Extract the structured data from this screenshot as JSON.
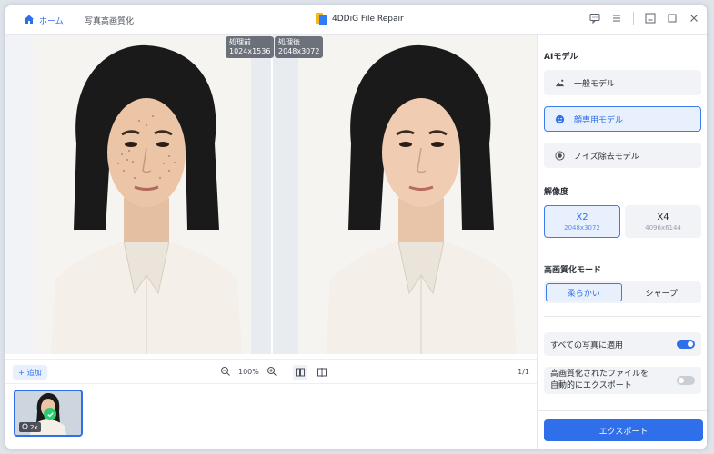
{
  "titlebar": {
    "home_label": "ホーム",
    "breadcrumb": "写真高画質化",
    "app_title": "4DDiG File Repair"
  },
  "preview": {
    "before_label": "処理前",
    "before_size": "1024x1536",
    "after_label": "処理後",
    "after_size": "2048x3072"
  },
  "toolbar": {
    "add_label": "追加",
    "zoom_value": "100%",
    "page_count": "1/1"
  },
  "thumbnail": {
    "scale_badge": "2x"
  },
  "panel": {
    "ai_model_title": "AIモデル",
    "models": [
      {
        "label": "一般モデル",
        "icon": "landscape-icon",
        "active": false
      },
      {
        "label": "顔専用モデル",
        "icon": "face-icon",
        "active": true
      },
      {
        "label": "ノイズ除去モデル",
        "icon": "denoise-icon",
        "active": false
      }
    ],
    "resolution_title": "解像度",
    "resolutions": [
      {
        "scale": "X2",
        "size": "2048x3072",
        "active": true
      },
      {
        "scale": "X4",
        "size": "4096x6144",
        "active": false
      }
    ],
    "mode_title": "高画質化モード",
    "modes": [
      {
        "label": "柔らかい",
        "active": true
      },
      {
        "label": "シャープ",
        "active": false
      }
    ],
    "apply_all_label": "すべての写真に適用",
    "apply_all_on": true,
    "auto_export_line1": "高画質化されたファイルを",
    "auto_export_line2": "自動的にエクスポート",
    "auto_export_on": false,
    "export_label": "エクスポート"
  },
  "colors": {
    "accent": "#2f6fea",
    "success": "#2ecc71"
  }
}
